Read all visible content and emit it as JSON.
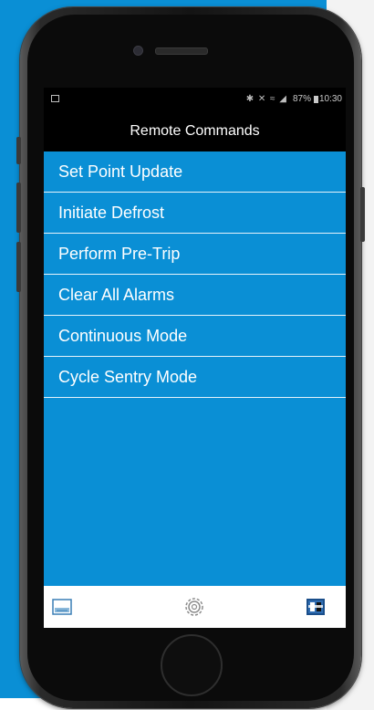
{
  "status_bar": {
    "icons": "✱ ✕ ≈ ◢",
    "battery": "87%",
    "time": "10:30"
  },
  "header": {
    "title": "Remote Commands"
  },
  "commands": [
    {
      "label": "Set Point Update"
    },
    {
      "label": "Initiate Defrost"
    },
    {
      "label": "Perform Pre-Trip"
    },
    {
      "label": "Clear All Alarms"
    },
    {
      "label": "Continuous Mode"
    },
    {
      "label": "Cycle Sentry Mode"
    }
  ],
  "bottom_nav": [
    {
      "icon": "dashboard-icon"
    },
    {
      "icon": "settings-gear-icon"
    },
    {
      "icon": "brand-logo-icon"
    }
  ],
  "colors": {
    "accent_blue": "#0a8fd5",
    "background": "#000000",
    "text": "#ffffff"
  }
}
